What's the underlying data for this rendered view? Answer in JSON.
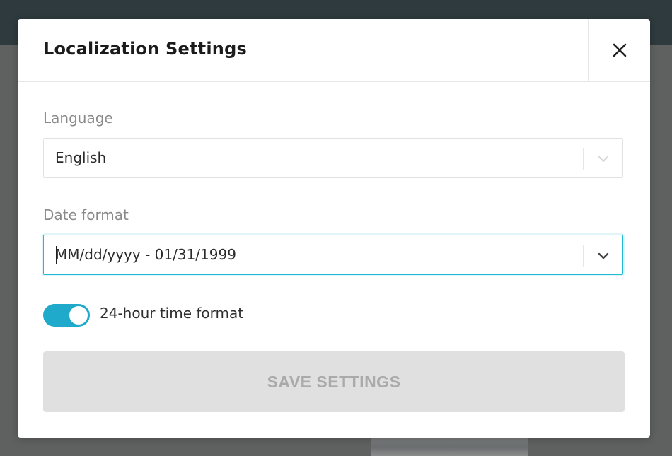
{
  "modal": {
    "title": "Localization Settings",
    "close_icon": "close-icon"
  },
  "language": {
    "label": "Language",
    "value": "English",
    "chevron_icon": "chevron-down-icon",
    "chevron_color": "#d8d8d8"
  },
  "date_format": {
    "label": "Date format",
    "value": "MM/dd/yyyy - 01/31/1999",
    "chevron_icon": "chevron-down-icon",
    "chevron_color": "#444444",
    "focused": true,
    "focus_color": "#23b8d6"
  },
  "time_format": {
    "label": "24-hour time format",
    "enabled": true,
    "toggle_color": "#1faacb"
  },
  "save_button": {
    "label": "SAVE SETTINGS",
    "disabled": true
  }
}
